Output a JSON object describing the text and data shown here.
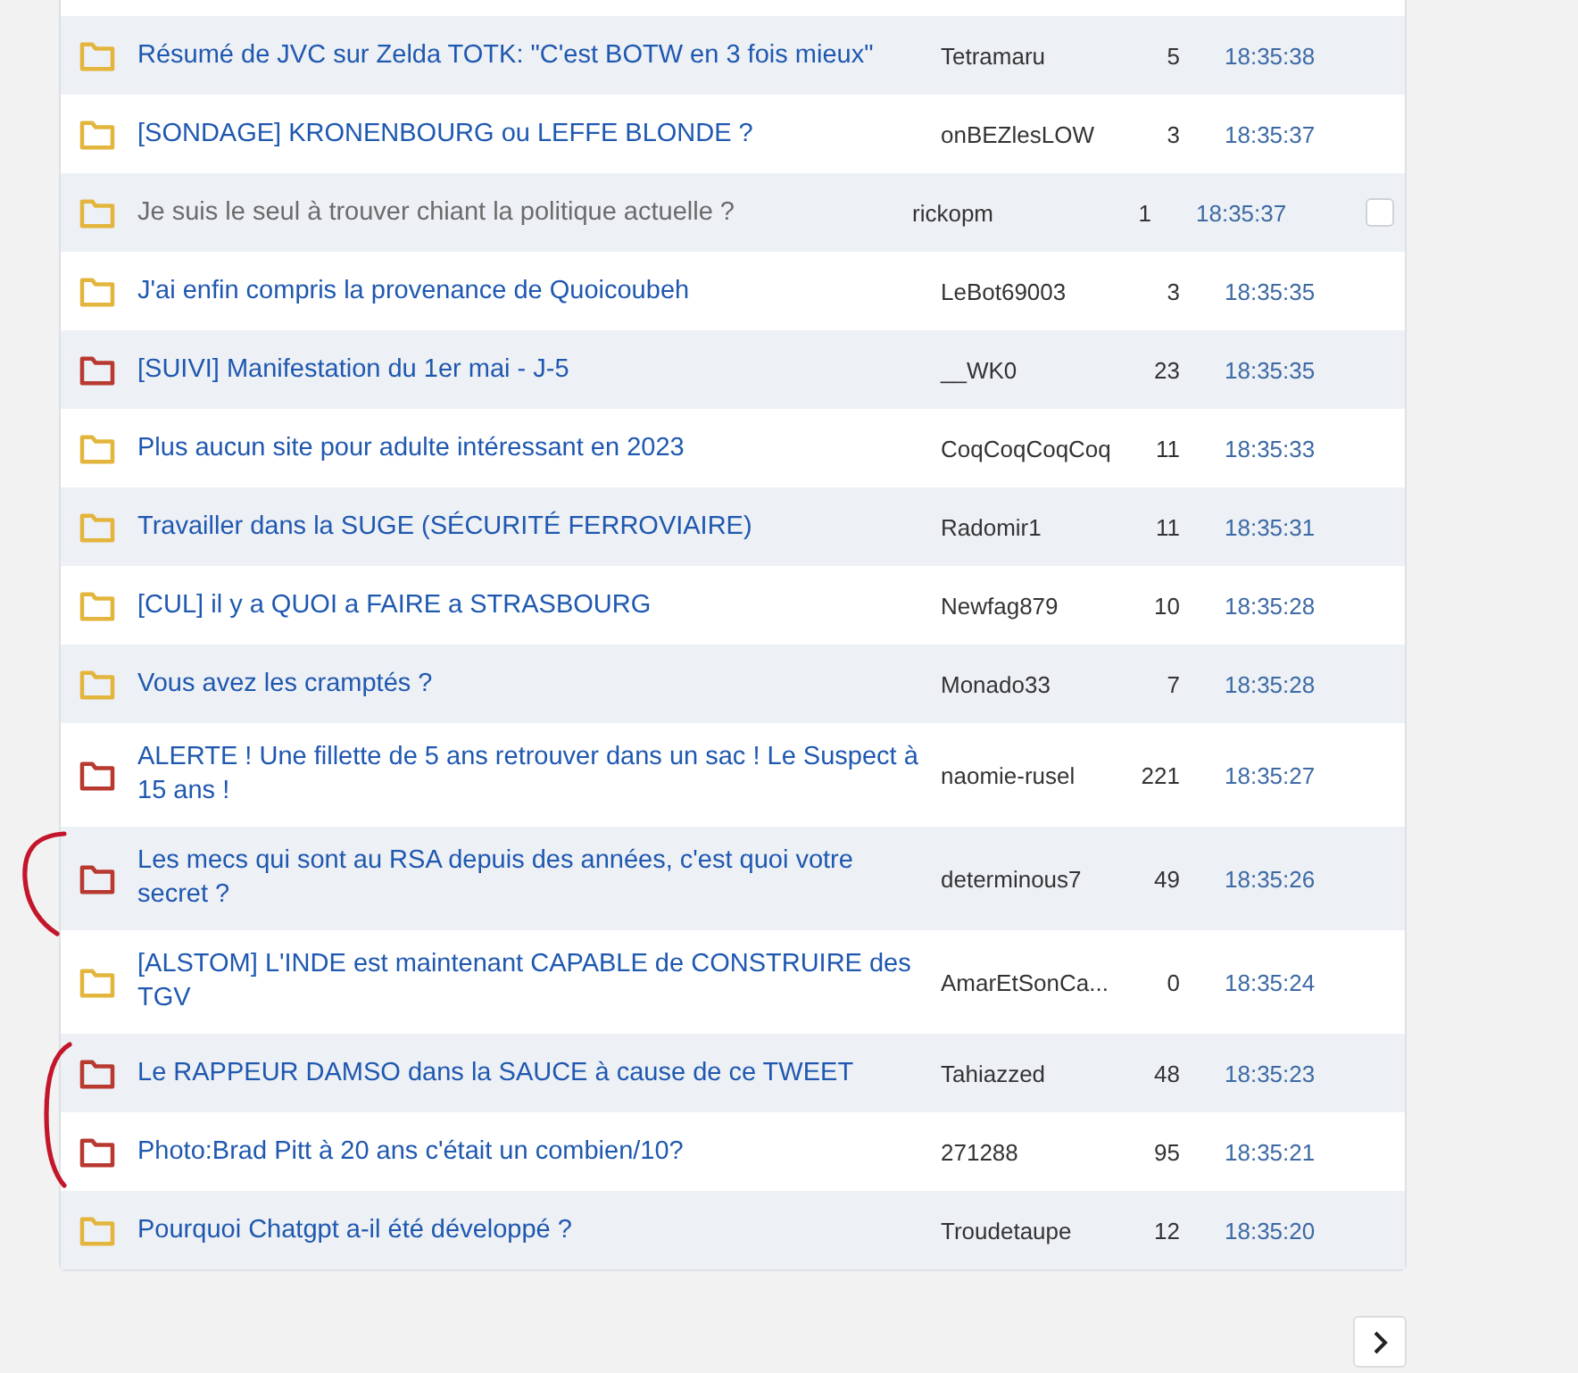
{
  "topics": [
    {
      "title": "Résumé de JVC sur Zelda TOTK: \"C'est BOTW en 3 fois mieux\"",
      "author": "Tetramaru",
      "replies": "5",
      "time": "18:35:38",
      "color": "#e3b53c",
      "visited": false,
      "hovered": false
    },
    {
      "title": "[SONDAGE] KRONENBOURG ou LEFFE BLONDE ?",
      "author": "onBEZlesLOW",
      "replies": "3",
      "time": "18:35:37",
      "color": "#e3b53c",
      "visited": false,
      "hovered": false
    },
    {
      "title": "Je suis le seul à trouver chiant la politique actuelle ?",
      "author": "rickopm",
      "replies": "1",
      "time": "18:35:37",
      "color": "#e3b53c",
      "visited": true,
      "hovered": true
    },
    {
      "title": "J'ai enfin compris la provenance de Quoicoubeh",
      "author": "LeBot69003",
      "replies": "3",
      "time": "18:35:35",
      "color": "#e3b53c",
      "visited": false,
      "hovered": false
    },
    {
      "title": "[SUIVI] Manifestation du 1er mai - J-5",
      "author": "__WK0",
      "replies": "23",
      "time": "18:35:35",
      "color": "#b8392f",
      "visited": false,
      "hovered": false
    },
    {
      "title": "Plus aucun site pour adulte intéressant en 2023",
      "author": "CoqCoqCoqCoq",
      "replies": "11",
      "time": "18:35:33",
      "color": "#e3b53c",
      "visited": false,
      "hovered": false
    },
    {
      "title": "Travailler dans la SUGE (SÉCURITÉ FERROVIAIRE)",
      "author": "Radomir1",
      "replies": "11",
      "time": "18:35:31",
      "color": "#e3b53c",
      "visited": false,
      "hovered": false
    },
    {
      "title": "[CUL] il y a QUOI a FAIRE a STRASBOURG",
      "author": "Newfag879",
      "replies": "10",
      "time": "18:35:28",
      "color": "#e3b53c",
      "visited": false,
      "hovered": false
    },
    {
      "title": "Vous avez les cramptés ?",
      "author": "Monado33",
      "replies": "7",
      "time": "18:35:28",
      "color": "#e3b53c",
      "visited": false,
      "hovered": false
    },
    {
      "title": "ALERTE ! Une fillette de 5 ans retrouver dans un sac ! Le Suspect à 15 ans !",
      "author": "naomie-rusel",
      "replies": "221",
      "time": "18:35:27",
      "color": "#b8392f",
      "visited": false,
      "hovered": false
    },
    {
      "title": "Les mecs qui sont au RSA depuis des années, c'est quoi votre secret ?",
      "author": "determinous7",
      "replies": "49",
      "time": "18:35:26",
      "color": "#b8392f",
      "visited": false,
      "hovered": false
    },
    {
      "title": "[ALSTOM] L'INDE est maintenant CAPABLE de CONSTRUIRE des TGV",
      "author": "AmarEtSonCa...",
      "replies": "0",
      "time": "18:35:24",
      "color": "#e3b53c",
      "visited": false,
      "hovered": false
    },
    {
      "title": "Le RAPPEUR DAMSO dans la SAUCE à cause de ce TWEET",
      "author": "Tahiazzed",
      "replies": "48",
      "time": "18:35:23",
      "color": "#b8392f",
      "visited": false,
      "hovered": false
    },
    {
      "title": "Photo:Brad Pitt à 20 ans c'était un combien/10?",
      "author": "271288",
      "replies": "95",
      "time": "18:35:21",
      "color": "#b8392f",
      "visited": false,
      "hovered": false
    },
    {
      "title": "Pourquoi Chatgpt a-il été développé ?",
      "author": "Troudetaupe",
      "replies": "12",
      "time": "18:35:20",
      "color": "#e3b53c",
      "visited": false,
      "hovered": false
    }
  ]
}
